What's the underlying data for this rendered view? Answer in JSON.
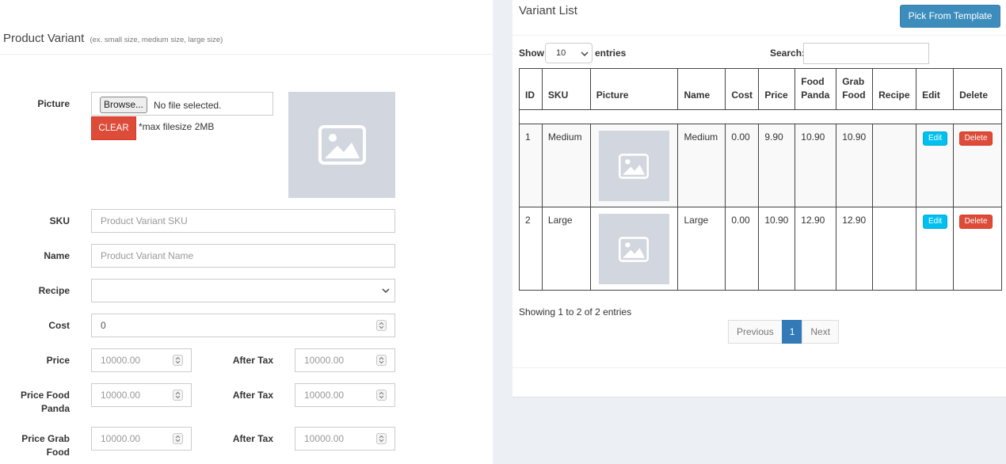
{
  "form": {
    "title": "Product Variant",
    "subtitle": "(ex. small size, medium size, large size)",
    "picture_label": "Picture",
    "browse_label": "Browse...",
    "file_status": "No file selected.",
    "clear_label": "CLEAR",
    "max_note": "*max filesize 2MB",
    "sku_label": "SKU",
    "sku_placeholder": "Product Variant SKU",
    "name_label": "Name",
    "name_placeholder": "Product Variant Name",
    "recipe_label": "Recipe",
    "recipe_value": "",
    "cost_label": "Cost",
    "cost_value": "0",
    "price_label": "Price",
    "price_value": "10000.00",
    "price_after_tax_label": "After Tax",
    "price_after_tax_value": "10000.00",
    "price_foodpanda_label_1": "Price Food",
    "price_foodpanda_label_2": "Panda",
    "price_foodpanda_value": "10000.00",
    "foodpanda_after_tax_label": "After Tax",
    "foodpanda_after_tax_value": "10000.00",
    "price_grabfood_label_1": "Price Grab",
    "price_grabfood_label_2": "Food",
    "price_grabfood_value": "10000.00",
    "grabfood_after_tax_label": "After Tax",
    "grabfood_after_tax_value": "10000.00",
    "colors": {
      "clear": "#dd4b39",
      "placeholder_bg": "#d2d6de"
    }
  },
  "variant_list": {
    "title": "Variant List",
    "pick_template_label": "Pick From Template",
    "show_label": "Show",
    "page_length": "10",
    "entries_label": "entries",
    "search_label": "Search:",
    "search_value": "",
    "columns": [
      "ID",
      "SKU",
      "Picture",
      "Name",
      "Cost",
      "Price",
      "Food Panda",
      "Grab Food",
      "Recipe",
      "Edit",
      "Delete"
    ],
    "column_lines": {
      "food_panda_1": "Food",
      "food_panda_2": "Panda",
      "grab_food_1": "Grab",
      "grab_food_2": "Food"
    },
    "rows": [
      {
        "id": "1",
        "sku": "Medium",
        "name": "Medium",
        "cost": "0.00",
        "price": "9.90",
        "food_panda": "10.90",
        "grab_food": "10.90",
        "recipe": "",
        "edit": "Edit",
        "delete": "Delete"
      },
      {
        "id": "2",
        "sku": "Large",
        "name": "Large",
        "cost": "0.00",
        "price": "10.90",
        "food_panda": "12.90",
        "grab_food": "12.90",
        "recipe": "",
        "edit": "Edit",
        "delete": "Delete"
      }
    ],
    "info": "Showing 1 to 2 of 2 entries",
    "pager": {
      "previous": "Previous",
      "current": "1",
      "next": "Next"
    },
    "colors": {
      "primary": "#3c8dbc",
      "edit": "#00c0ef",
      "delete": "#dd4b39"
    }
  }
}
